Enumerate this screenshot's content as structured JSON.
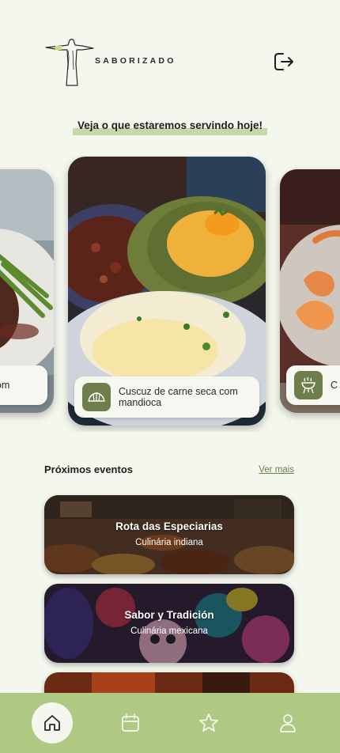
{
  "header": {
    "brand": "SABORIZADO",
    "logo_icon": "christ-the-redeemer-logo",
    "logout_icon": "logout-icon"
  },
  "headline": "Veja o que estaremos servindo hoje!",
  "carousel": {
    "left_caption": "ca com",
    "main_caption": "Cuscuz de carne seca com mandioca",
    "main_icon": "croissant-icon",
    "right_caption": "C m",
    "right_icon": "grill-icon"
  },
  "events": {
    "title": "Próximos eventos",
    "see_more": "Ver mais",
    "items": [
      {
        "title": "Rota das Especiarias",
        "subtitle": "Culinária indiana"
      },
      {
        "title": "Sabor y Tradición",
        "subtitle": "Culinária mexicana"
      }
    ]
  },
  "nav": {
    "items": [
      "home-icon",
      "calendar-icon",
      "star-icon",
      "user-icon"
    ]
  },
  "colors": {
    "background": "#f4f7ee",
    "accent": "#afc884",
    "highlight": "#c5d9a7",
    "badge": "#6f7f4b"
  }
}
